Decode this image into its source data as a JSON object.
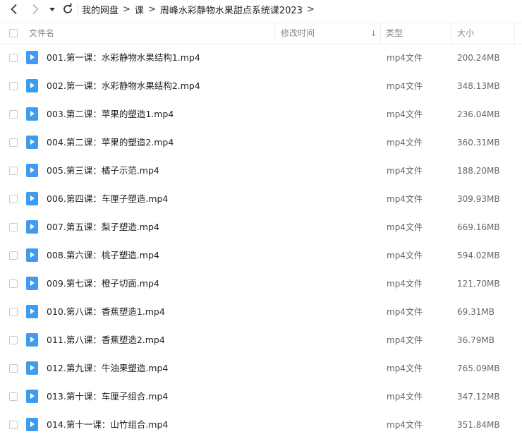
{
  "toolbar": {
    "breadcrumbs": [
      "我的网盘",
      "课",
      "周峰水彩静物水果甜点系统课2023"
    ],
    "separator": ">"
  },
  "header": {
    "name": "文件名",
    "modified": "修改时间",
    "type": "类型",
    "size": "大小",
    "sort_arrow": "↓"
  },
  "files": [
    {
      "name": "001.第一课：水彩静物水果结构1.mp4",
      "type": "mp4文件",
      "size": "200.24MB"
    },
    {
      "name": "002.第一课：水彩静物水果结构2.mp4",
      "type": "mp4文件",
      "size": "348.13MB"
    },
    {
      "name": "003.第二课：苹果的塑造1.mp4",
      "type": "mp4文件",
      "size": "236.04MB"
    },
    {
      "name": "004.第二课：苹果的塑造2.mp4",
      "type": "mp4文件",
      "size": "360.31MB"
    },
    {
      "name": "005.第三课：橘子示范.mp4",
      "type": "mp4文件",
      "size": "188.20MB"
    },
    {
      "name": "006.第四课：车厘子塑造.mp4",
      "type": "mp4文件",
      "size": "309.93MB"
    },
    {
      "name": "007.第五课：梨子塑造.mp4",
      "type": "mp4文件",
      "size": "669.16MB"
    },
    {
      "name": "008.第六课：桃子塑造.mp4",
      "type": "mp4文件",
      "size": "594.02MB"
    },
    {
      "name": "009.第七课：橙子切面.mp4",
      "type": "mp4文件",
      "size": "121.70MB"
    },
    {
      "name": "010.第八课：香蕉塑造1.mp4",
      "type": "mp4文件",
      "size": "69.31MB"
    },
    {
      "name": "011.第八课：香蕉塑造2.mp4",
      "type": "mp4文件",
      "size": "36.79MB"
    },
    {
      "name": "012.第九课：牛油果塑造.mp4",
      "type": "mp4文件",
      "size": "765.09MB"
    },
    {
      "name": "013.第十课：车厘子组合.mp4",
      "type": "mp4文件",
      "size": "347.12MB"
    },
    {
      "name": "014.第十一课：山竹组合.mp4",
      "type": "mp4文件",
      "size": "351.84MB"
    }
  ],
  "colors": {
    "accent": "#3d9bf0",
    "border": "#eeeeee",
    "muted": "#888888"
  }
}
